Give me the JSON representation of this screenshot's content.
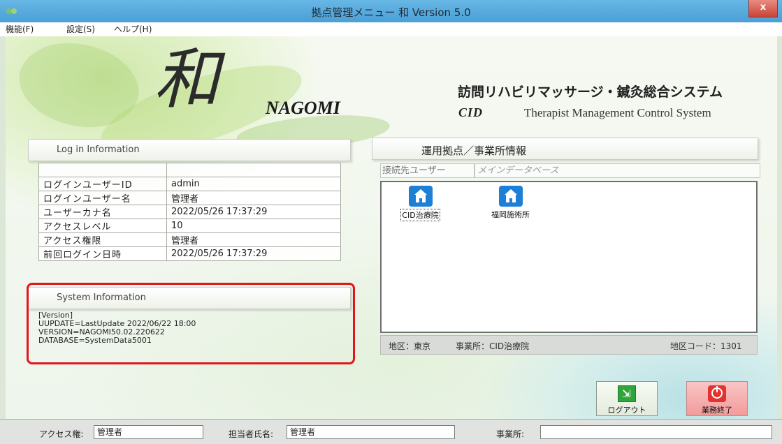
{
  "window": {
    "title": "拠点管理メニュー 和 Version 5.0",
    "close_label": "x"
  },
  "menu": [
    {
      "label": "機能(F)"
    },
    {
      "label": "設定(S)"
    },
    {
      "label": "ヘルプ(H)"
    }
  ],
  "branding": {
    "kanji": "和",
    "nagomi": "NAGOMI",
    "system_name": "訪問リハビリマッサージ・鍼灸総合システム",
    "company_logo": "CID",
    "subtitle": "Therapist Management Control System"
  },
  "login_info": {
    "header": "Log in Information",
    "rows": [
      {
        "key": "ログインユーザーID",
        "value": "admin"
      },
      {
        "key": "ログインユーザー名",
        "value": "管理者"
      },
      {
        "key": "ユーザーカナ名",
        "value": "2022/05/26 17:37:29"
      },
      {
        "key": "アクセスレベル",
        "value": "10"
      },
      {
        "key": "アクセス権限",
        "value": "管理者"
      },
      {
        "key": "前回ログイン日時",
        "value": "2022/05/26 17:37:29"
      }
    ]
  },
  "system_info": {
    "header": "System Information",
    "lines": [
      "[Version]",
      "UUPDATE=LastUpdate 2022/06/22 18:00",
      "VERSION=NAGOMI50.02.220622",
      "DATABASE=SystemData5001"
    ]
  },
  "office_info": {
    "header": "運用拠点／事業所情報",
    "connection_user_label": "接続先ユーザー",
    "main_database": "メインデータベース",
    "offices": [
      {
        "label": "CID治療院",
        "icon": "house-icon",
        "selected": true
      },
      {
        "label": "福岡施術所",
        "icon": "house-icon",
        "selected": false
      }
    ],
    "status": {
      "region": "地区：東京",
      "office": "事業所：CID治療院",
      "region_code": "地区コード：1301"
    }
  },
  "buttons": {
    "logout": {
      "label": "ログアウト",
      "icon": "exit-door-icon"
    },
    "exit": {
      "label": "業務終了",
      "icon": "power-icon"
    }
  },
  "statusbar": {
    "access_label": "アクセス権:",
    "access_value": "管理者",
    "staff_label": "担当者氏名:",
    "staff_value": "管理者",
    "office_label": "事業所:",
    "office_value": ""
  },
  "colors": {
    "titlebar": "#4b9fd6",
    "highlight_frame": "#e4141b",
    "house_icon": "#1d7fd6",
    "logout_icon": "#2fa53b",
    "exit_button": "#f39b9b"
  }
}
